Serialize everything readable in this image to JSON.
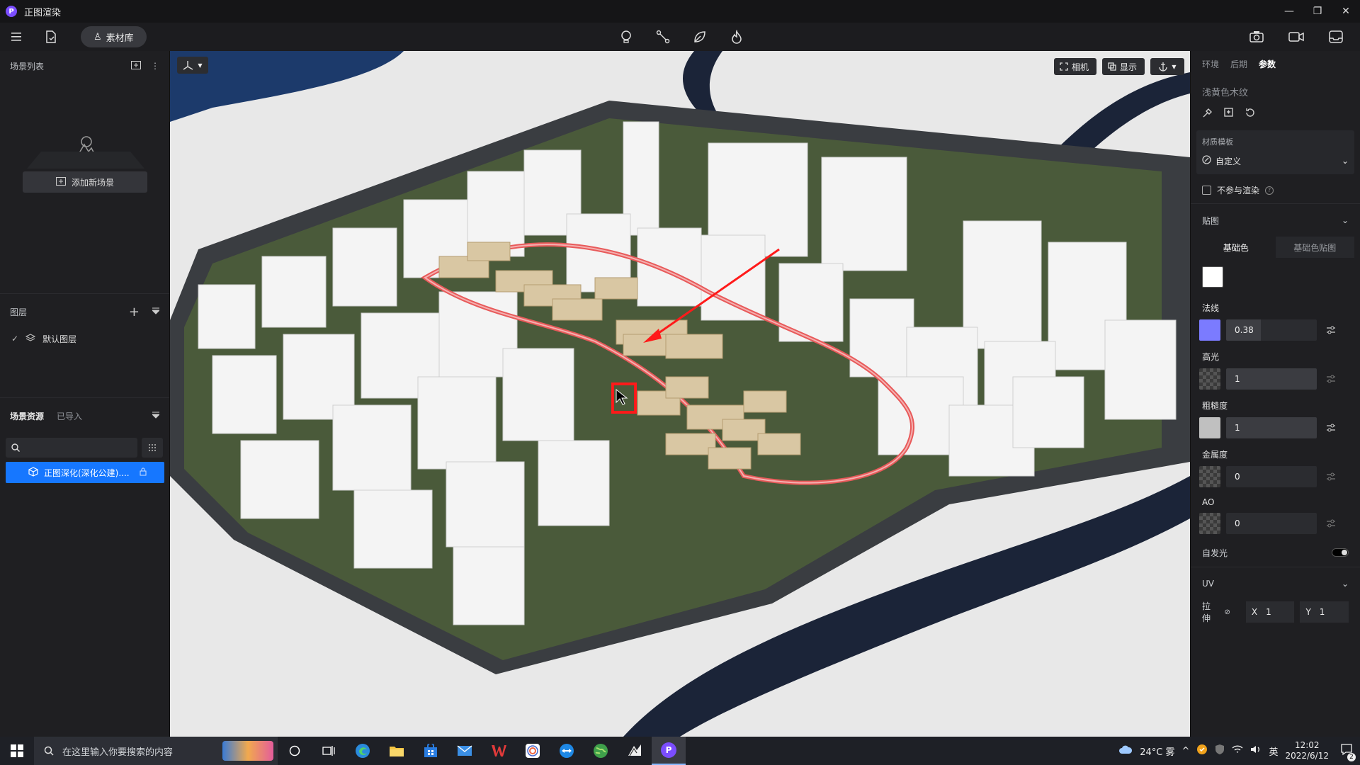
{
  "window": {
    "title": "正图渲染",
    "logo": "P"
  },
  "toolbar": {
    "library_label": "素材库"
  },
  "scene_list": {
    "title": "场景列表",
    "add_scene_label": "添加新场景"
  },
  "layers": {
    "title": "图层",
    "items": [
      {
        "label": "默认图层",
        "checked": true
      }
    ]
  },
  "scene_resources": {
    "tab_active": "场景资源",
    "tab_imported": "已导入",
    "search_placeholder": "",
    "items": [
      {
        "label": "正图深化(深化公建)...."
      }
    ]
  },
  "viewport": {
    "camera_label": "相机",
    "display_label": "显示"
  },
  "right_panel": {
    "tabs": [
      "环境",
      "后期",
      "参数"
    ],
    "active_tab": "参数",
    "material_name": "浅黄色木纹",
    "template_label": "材质模板",
    "template_value": "自定义",
    "no_render_label": "不参与渲染",
    "texture_section": "贴图",
    "texture_tabs": [
      "基础色",
      "基础色贴图"
    ],
    "base_color": "#ffffff",
    "params": [
      {
        "label": "法线",
        "value": "0.38",
        "swatch": "#7b7bff",
        "fill": 0.38
      },
      {
        "label": "高光",
        "value": "1",
        "swatch": "checker"
      },
      {
        "label": "粗糙度",
        "value": "1",
        "swatch": "#c0c0c0"
      },
      {
        "label": "金属度",
        "value": "0",
        "swatch": "checker"
      },
      {
        "label": "AO",
        "value": "0",
        "swatch": "checker"
      }
    ],
    "emissive_label": "自发光",
    "uv_section": "UV",
    "uv_stretch_label": "拉伸",
    "uv_x_label": "X",
    "uv_x": "1",
    "uv_y_label": "Y",
    "uv_y": "1"
  },
  "taskbar": {
    "search_placeholder": "在这里输入你要搜索的内容",
    "weather": "24°C 雾",
    "lang": "英",
    "time": "12:02",
    "date": "2022/6/12",
    "notifications": "2"
  }
}
